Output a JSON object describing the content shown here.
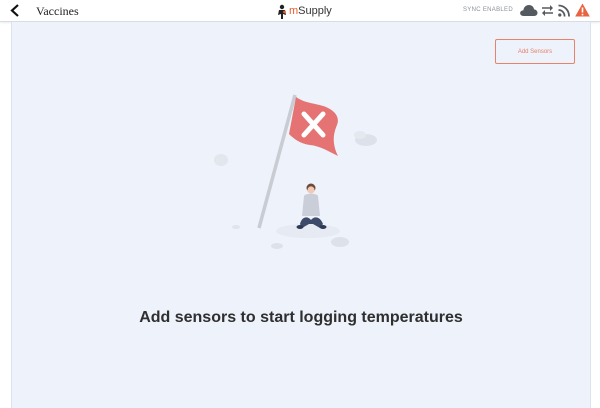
{
  "header": {
    "title": "Vaccines",
    "logo_prefix": "m",
    "logo_suffix": "Supply",
    "sync_status": "SYNC ENABLED",
    "icons": [
      "back-arrow-icon",
      "cloud-icon",
      "sync-arrows-icon",
      "rss-feed-icon",
      "warning-icon"
    ]
  },
  "main": {
    "add_sensor_label": "Add Sensors",
    "empty_message": "Add sensors to start logging temperatures",
    "illustration": "person-sitting-with-flag-x"
  },
  "colors": {
    "accent": "#e8826a",
    "flag": "#e57373",
    "warning": "#e8633f",
    "background": "#edf2fb"
  }
}
